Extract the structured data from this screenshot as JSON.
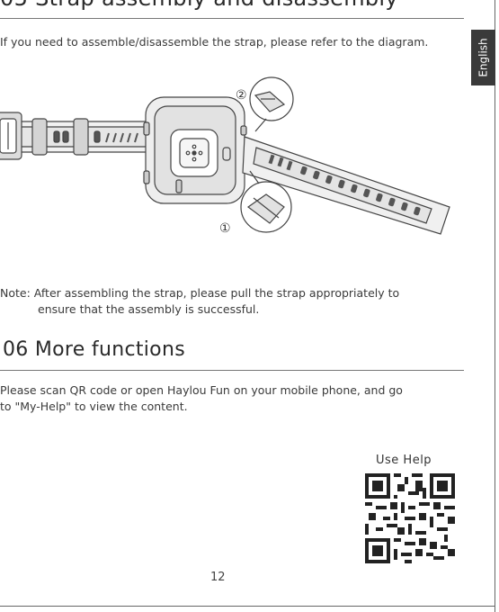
{
  "header": {
    "title": "05  Strap assembly and disassembly",
    "language_tab": "English"
  },
  "strap_section": {
    "intro": "If you need to assemble/disassemble the strap, please refer to the diagram.",
    "callout_1": "①",
    "callout_2": "②",
    "note_line1": "Note: After assembling the strap, please pull the strap appropriately to",
    "note_line2": "ensure that the assembly is successful."
  },
  "more_section": {
    "title": "06  More functions",
    "text_line1": "Please scan QR code or open Haylou Fun on your mobile phone, and go",
    "text_line2": "to \"My-Help\" to view the content.",
    "qr_label": "Use Help"
  },
  "footer": {
    "page_number": "12"
  },
  "colors": {
    "text": "#333333",
    "tab_bg": "#3a3a3a",
    "strap": "#e9e9e9",
    "outline": "#444444"
  },
  "icons": [
    "watch-illustration",
    "qr-code-icon",
    "zoom-detail-icon"
  ]
}
